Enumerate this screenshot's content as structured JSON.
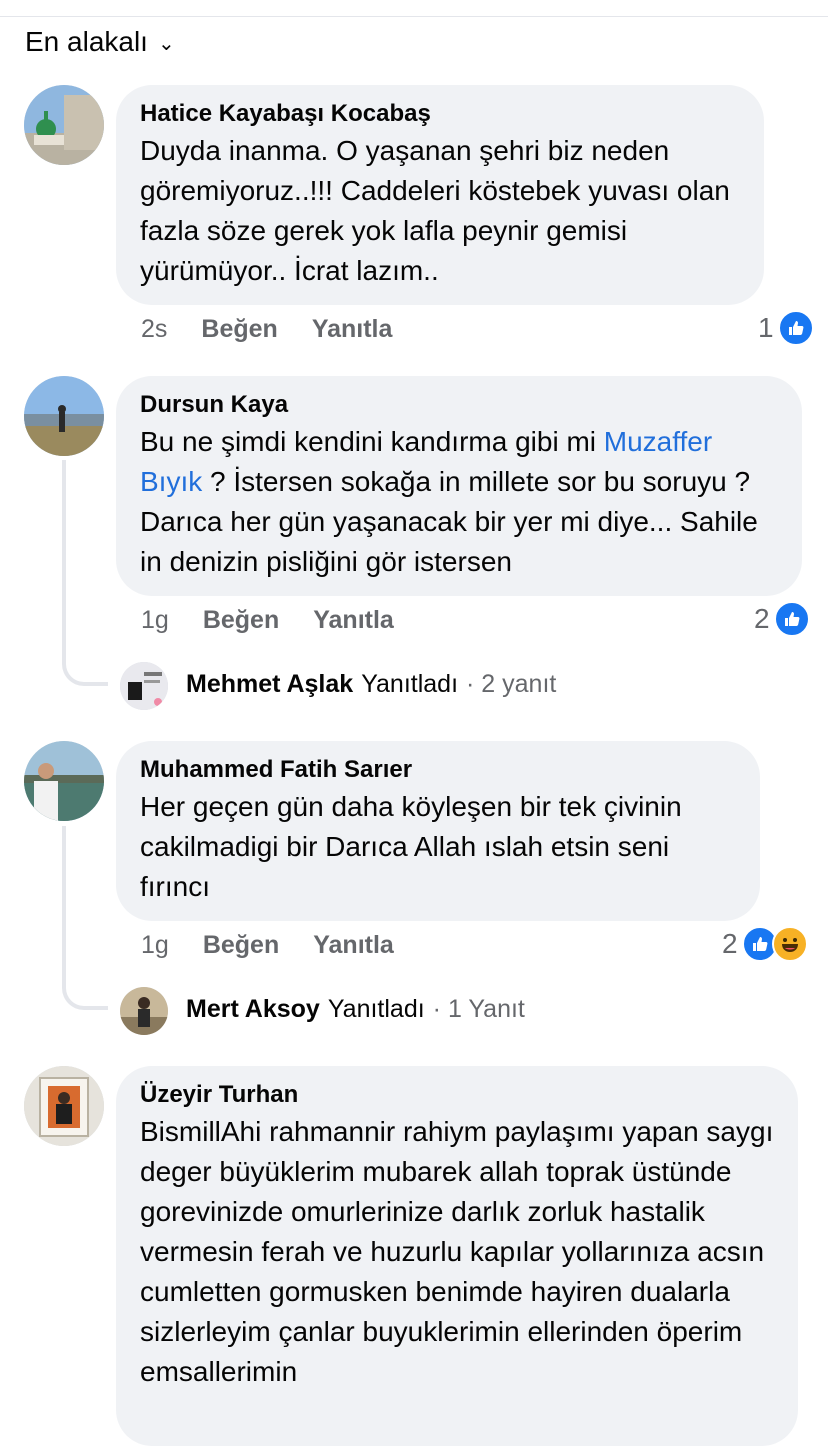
{
  "sort": {
    "label": "En alakalı"
  },
  "comments": [
    {
      "author": "Hatice Kayabaşı Kocabaş",
      "text": "Duyda inanma. O yaşanan şehri biz neden göremiyoruz..!!! Caddeleri köstebek yuvası olan fazla söze gerek yok lafla peynir gemisi yürümüyor.. İcrat lazım..",
      "time": "2s",
      "like": "Beğen",
      "reply": "Yanıtla",
      "reaction_count": "1"
    },
    {
      "author": "Dursun Kaya",
      "text_before": "Bu ne şimdi kendini kandırma gibi mi ",
      "mention": "Muzaffer Bıyık",
      "text_after": " ? İstersen sokağa in millete sor bu soruyu ? Darıca her gün yaşanacak bir yer mi diye... Sahile in denizin pisliğini gör istersen",
      "time": "1g",
      "like": "Beğen",
      "reply": "Yanıtla",
      "reaction_count": "2",
      "replies": {
        "name": "Mehmet Aşlak",
        "verb": "Yanıtladı",
        "count": "· 2 yanıt"
      }
    },
    {
      "author": "Muhammed Fatih Sarıer",
      "text": "Her geçen gün daha köyleşen bir tek çivinin cakilmadigi bir Darıca Allah ıslah etsin seni fırıncı",
      "time": "1g",
      "like": "Beğen",
      "reply": "Yanıtla",
      "reaction_count": "2",
      "replies": {
        "name": "Mert Aksoy",
        "verb": "Yanıtladı",
        "count": "· 1 Yanıt"
      }
    },
    {
      "author": "Üzeyir Turhan",
      "text": "BismillAhi rahmannir rahiym paylaşımı yapan saygı deger büyüklerim mubarek allah toprak üstünde gorevinizde omurlerinize darlık zorluk hastalik vermesin ferah ve huzurlu kapılar yollarınıza acsın cumletten gormusken benimde hayiren dualarla sizlerleyim çanlar buyuklerimin ellerinden öperim emsallerimin"
    }
  ],
  "colors": {
    "link": "#216fdb",
    "like": "#1877f2",
    "bubble": "#f0f2f5",
    "secondary": "#65676b"
  }
}
